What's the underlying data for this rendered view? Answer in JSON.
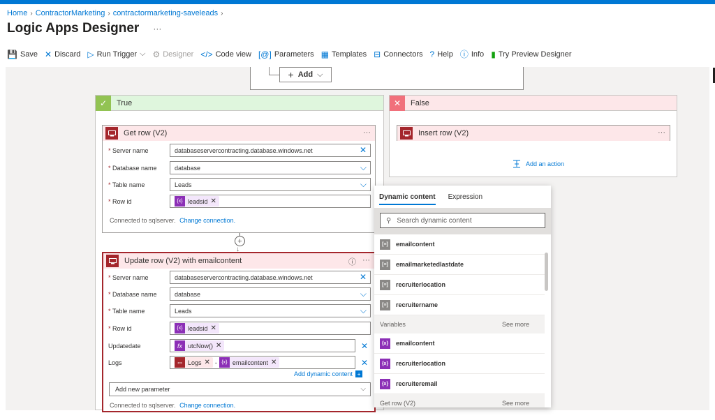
{
  "breadcrumb": [
    "Home",
    "ContractorMarketing",
    "contractormarketing-saveleads"
  ],
  "page_title": "Logic Apps Designer",
  "page_more": "···",
  "toolbar": [
    {
      "label": "Save",
      "icon": "save-icon",
      "glyph": "💾",
      "disabled": false
    },
    {
      "label": "Discard",
      "icon": "close-icon",
      "glyph": "✕",
      "disabled": false
    },
    {
      "label": "Run Trigger",
      "icon": "play-icon",
      "glyph": "▷",
      "disabled": false,
      "dropdown": true
    },
    {
      "label": "Designer",
      "icon": "designer-icon",
      "glyph": "⚙",
      "disabled": true
    },
    {
      "label": "Code view",
      "icon": "code-icon",
      "glyph": "</>",
      "disabled": false
    },
    {
      "label": "Parameters",
      "icon": "parameters-icon",
      "glyph": "[@]",
      "disabled": false
    },
    {
      "label": "Templates",
      "icon": "templates-icon",
      "glyph": "▦",
      "disabled": false
    },
    {
      "label": "Connectors",
      "icon": "connectors-icon",
      "glyph": "⊟",
      "disabled": false
    },
    {
      "label": "Help",
      "icon": "help-icon",
      "glyph": "?",
      "disabled": false
    },
    {
      "label": "Info",
      "icon": "info-icon",
      "glyph": "ⓘ",
      "disabled": false
    },
    {
      "label": "Try Preview Designer",
      "icon": "bookmark-icon",
      "glyph": "▮",
      "disabled": false
    }
  ],
  "add_button": "Add",
  "scope_true": {
    "label": "True"
  },
  "scope_false": {
    "label": "False"
  },
  "get_row": {
    "title": "Get row (V2)",
    "more": "···",
    "fields": {
      "server_label": "Server name",
      "server_value": "databaseservercontracting.database.windows.net",
      "db_label": "Database name",
      "db_value": "database",
      "table_label": "Table name",
      "table_value": "Leads",
      "rowid_label": "Row id",
      "rowid_token": "leadsid"
    },
    "connected": "Connected to sqlserver.",
    "change": "Change connection."
  },
  "insert_row": {
    "title": "Insert row (V2)",
    "more": "···"
  },
  "add_action": "Add an action",
  "update_row": {
    "title": "Update row (V2) with emailcontent",
    "more": "···",
    "info": "ⓘ",
    "fields": {
      "server_label": "Server name",
      "server_value": "databaseservercontracting.database.windows.net",
      "db_label": "Database name",
      "db_value": "database",
      "table_label": "Table name",
      "table_value": "Leads",
      "rowid_label": "Row id",
      "rowid_token": "leadsid",
      "updatedate_label": "Updatedate",
      "updatedate_token": "utcNow()",
      "logs_label": "Logs",
      "logs_token1": "Logs",
      "logs_sep": "-",
      "logs_token2": "emailcontent"
    },
    "add_dynamic": "Add dynamic content",
    "add_param": "Add new parameter",
    "connected": "Connected to sqlserver.",
    "change": "Change connection."
  },
  "dynamic_panel": {
    "tab_dynamic": "Dynamic content",
    "tab_expression": "Expression",
    "search_placeholder": "Search dynamic content",
    "items_top": [
      "emailcontent",
      "emailmarketedlastdate",
      "recruiterlocation",
      "recruitername"
    ],
    "variables_header": "Variables",
    "see_more": "See more",
    "variables": [
      "emailcontent",
      "recruiterlocation",
      "recruiteremail"
    ],
    "getrow_header": "Get row (V2)"
  }
}
